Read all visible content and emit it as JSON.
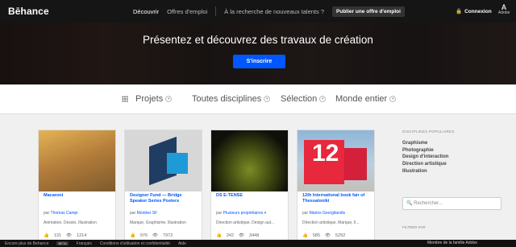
{
  "header": {
    "logo": "Bēhance",
    "nav": [
      "Découvrir",
      "Offres d'emploi",
      "À la recherche de nouveaux talents ?"
    ],
    "post_job": "Publier une offre d'emploi",
    "login": "Connexion",
    "adobe": "Adobe"
  },
  "hero": {
    "title": "Présentez et découvrez des travaux de création",
    "signup": "S'inscrire"
  },
  "filters": [
    "Projets",
    "Toutes disciplines",
    "Sélection",
    "Monde entier"
  ],
  "cards": [
    {
      "title": "Macaroni",
      "owner_prefix": "par",
      "owner": "Thomas Campi",
      "fields": "Animation, Dessin, Illustration",
      "likes": "131",
      "views": "1214",
      "color": "#c79a4a"
    },
    {
      "title": "Designer Fund — Bridge Speaker Series Posters",
      "owner_prefix": "par",
      "owner": "Moniker SF",
      "fields": "Marque, Graphisme, Illustration",
      "likes": "976",
      "views": "7972",
      "color": "#1e7fb8"
    },
    {
      "title": "DS E-TENSE",
      "owner_prefix": "par",
      "owner": "Plusieurs propriétaires",
      "fields": "Direction artistique, Design aut...",
      "likes": "242",
      "views": "3448",
      "color": "#5a6b1a"
    },
    {
      "title": "12th International book fair of Thessaloniki",
      "owner_prefix": "par",
      "owner": "Marios Georgilandis",
      "fields": "Direction artistique, Marque, Il...",
      "likes": "585",
      "views": "5292",
      "color": "#e8283c"
    }
  ],
  "sidebar": {
    "title": "DISCIPLINES POPULAIRES",
    "items": [
      "Graphisme",
      "Photographie",
      "Design d'interaction",
      "Direction artistique",
      "Illustration"
    ],
    "search_placeholder": "Rechercher...",
    "filter_label": "FILTRER PAR"
  },
  "footer": {
    "links": [
      "Encore plus de Behance",
      "Français",
      "Conditions d'utilisation et confidentialité",
      "Aide"
    ],
    "beta": "BETA",
    "family": "Membre de la famille Adobe"
  }
}
